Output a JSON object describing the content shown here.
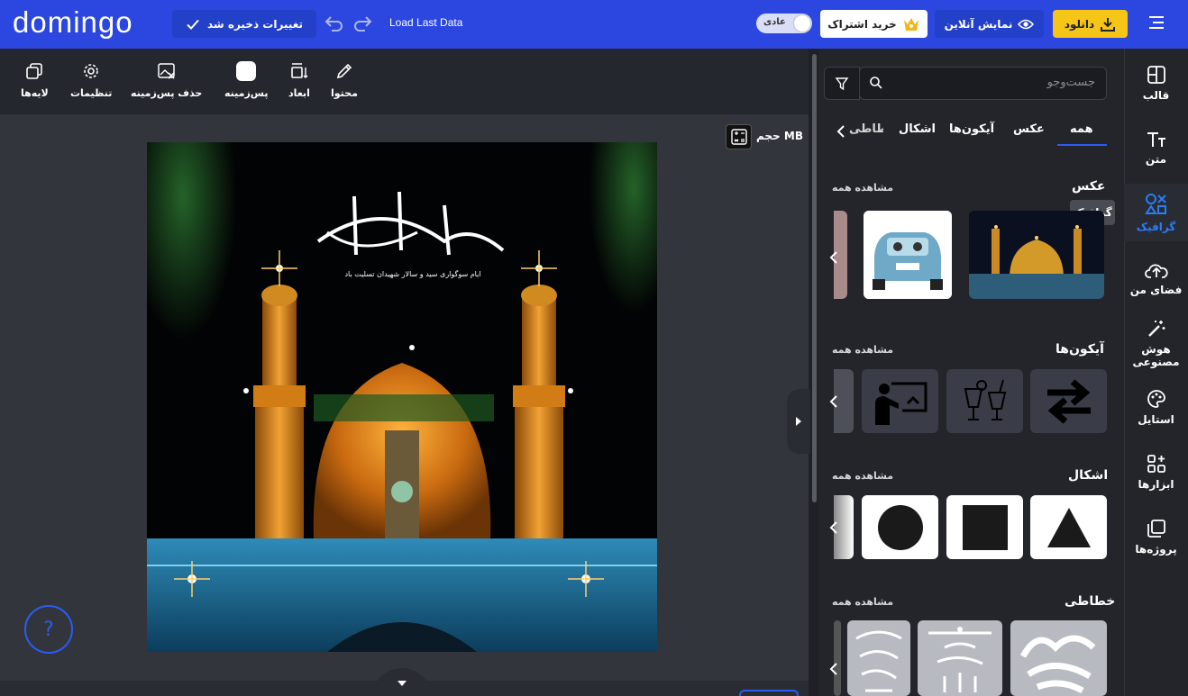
{
  "header": {
    "logo": "domingo",
    "saved_label": "تغییرات ذخیره شد",
    "load_last": "Load Last Data",
    "mode_label": "عادی",
    "subscribe_label": "خرید اشتراک",
    "online_label": "نمایش آنلاین",
    "download_label": "دانلود"
  },
  "toolbar": {
    "content": "محتوا",
    "dimensions": "ابعاد",
    "background": "پس‌زمینه",
    "remove_bg": "حذف پس‌زمینه",
    "settings": "تنظیمات",
    "layers": "لایه‌ها"
  },
  "canvas": {
    "size_label": "حجم MB",
    "help_label": "?"
  },
  "design": {
    "calligraphy": "یاقمر بنی هاشم",
    "subtitle": "ایام سوگواری سید و سالار شهیدان تسلیت باد"
  },
  "panel": {
    "search_placeholder": "جست‌وجو",
    "tabs": [
      "همه",
      "عکس",
      "آیکون‌ها",
      "اشکال",
      "خطاطی"
    ],
    "see_all": "مشاهده همه",
    "sections": {
      "photos": "عکس",
      "icons": "آیکون‌ها",
      "shapes": "اشکال",
      "calligraphy": "خطاطی"
    },
    "tooltip": "گرافیک"
  },
  "nav": {
    "template": "قالب",
    "text": "متن",
    "graphic": "گرافیک",
    "my_space": "فضای من",
    "ai": "هوش مصنوعی",
    "style": "استایل",
    "tools": "ابزارها",
    "projects": "پروژه‌ها"
  },
  "colors": {
    "brand_blue": "#2b47e0",
    "accent_yellow": "#f5c518",
    "active_blue": "#2b7cf5"
  }
}
